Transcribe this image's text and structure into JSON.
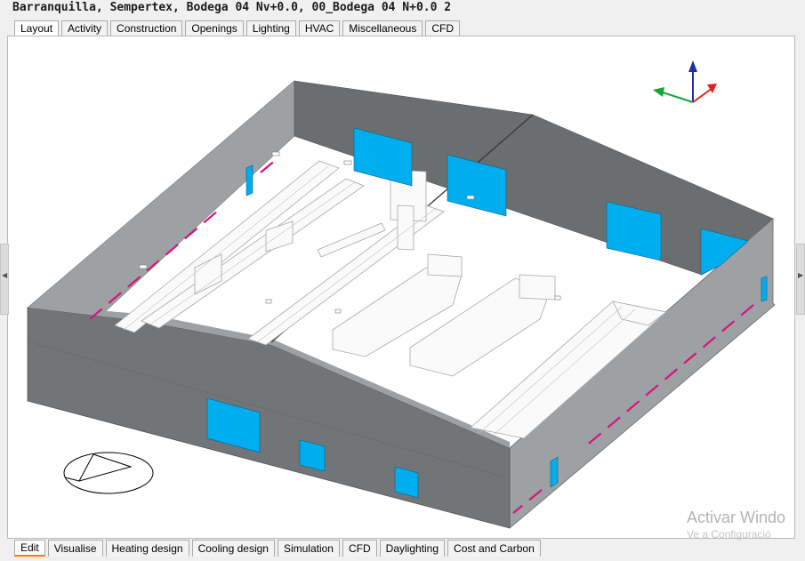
{
  "window": {
    "title": "Barranquilla, Sempertex, Bodega 04 Nv+0.0, 00_Bodega 04 N+0.0  2"
  },
  "top_tabs": [
    {
      "label": "Layout",
      "active": true
    },
    {
      "label": "Activity",
      "active": false
    },
    {
      "label": "Construction",
      "active": false
    },
    {
      "label": "Openings",
      "active": false
    },
    {
      "label": "Lighting",
      "active": false
    },
    {
      "label": "HVAC",
      "active": false
    },
    {
      "label": "Miscellaneous",
      "active": false
    },
    {
      "label": "CFD",
      "active": false
    }
  ],
  "bottom_tabs": [
    {
      "label": "Edit",
      "active": true
    },
    {
      "label": "Visualise",
      "active": false
    },
    {
      "label": "Heating design",
      "active": false
    },
    {
      "label": "Cooling design",
      "active": false
    },
    {
      "label": "Simulation",
      "active": false
    },
    {
      "label": "CFD",
      "active": false
    },
    {
      "label": "Daylighting",
      "active": false
    },
    {
      "label": "Cost and Carbon",
      "active": false
    }
  ],
  "watermark": {
    "line1": "Activar Windo",
    "line2": "Ve a Configuració"
  },
  "icons": {
    "axis_gizmo": "xyz-axes-icon",
    "navigation": "compass-ellipse-icon",
    "side_handles": "chevron-left-icon / chevron-right-icon"
  },
  "colors": {
    "wall": "#6f7274",
    "wall_light": "#9b9ea1",
    "window": "#00aeef",
    "vent_lines": "#d4147f",
    "axis_x": "#e02020",
    "axis_y": "#1aa33a",
    "axis_z": "#1c2fa8",
    "active_tab_underline": "#ff7a00"
  }
}
